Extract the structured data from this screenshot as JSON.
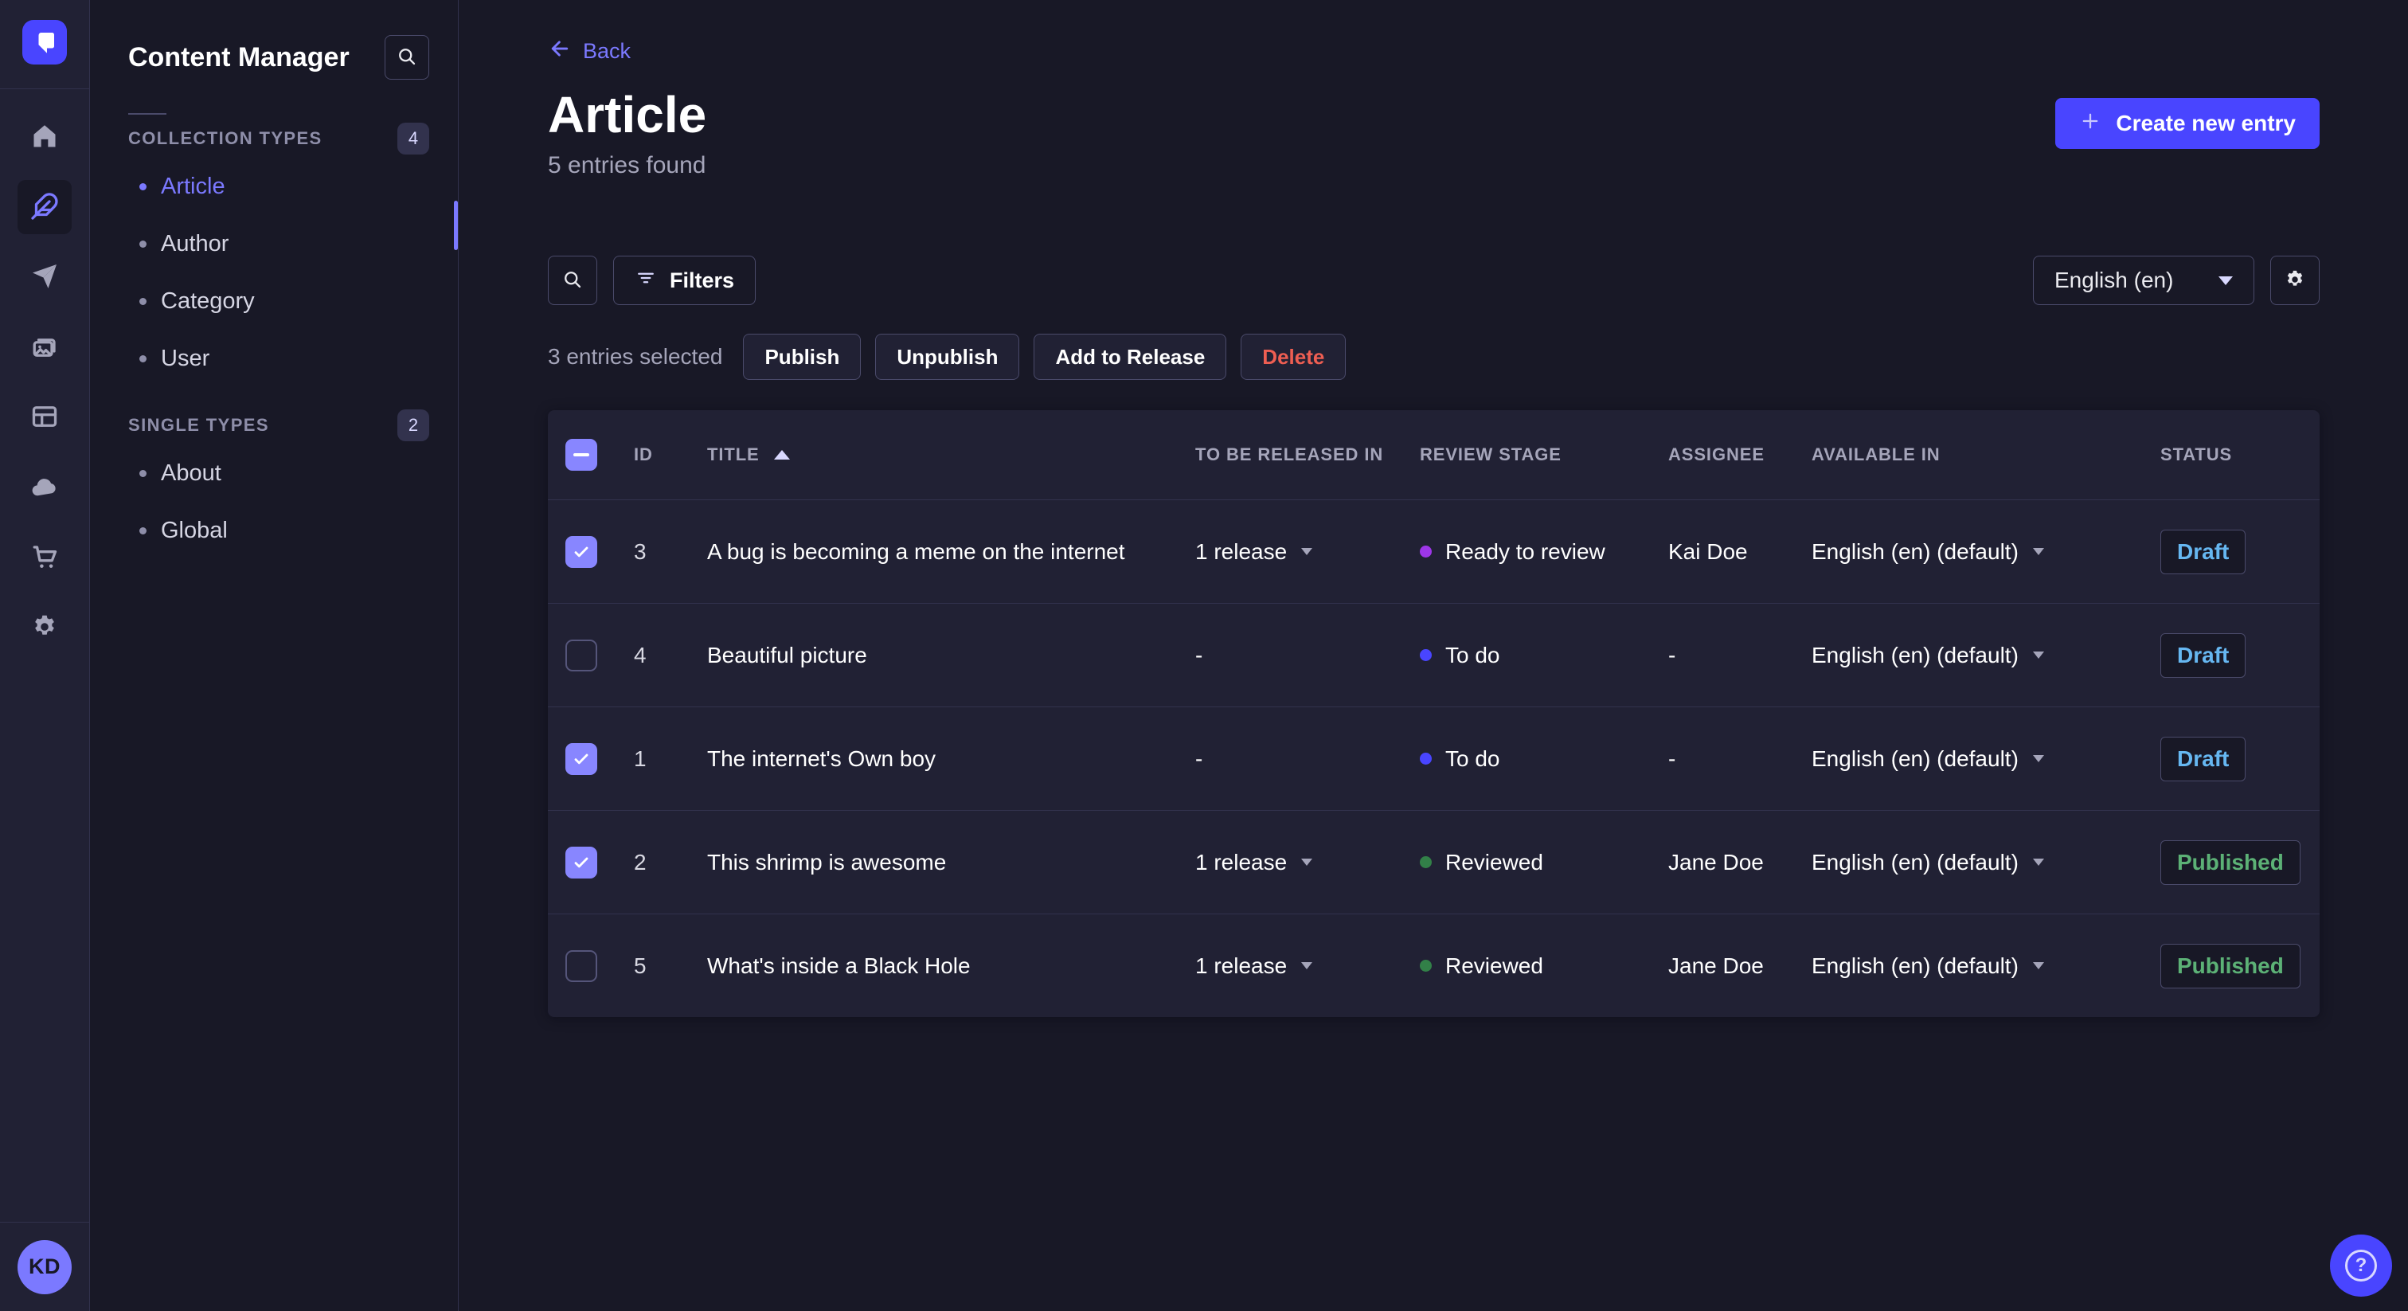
{
  "nav_rail": {
    "items": [
      {
        "icon": "home-icon",
        "active": false
      },
      {
        "icon": "feather-icon",
        "active": true
      },
      {
        "icon": "paper-plane-icon",
        "active": false
      },
      {
        "icon": "images-icon",
        "active": false
      },
      {
        "icon": "layout-icon",
        "active": false
      },
      {
        "icon": "cloud-icon",
        "active": false
      },
      {
        "icon": "cart-icon",
        "active": false
      },
      {
        "icon": "gear-icon",
        "active": false
      }
    ],
    "avatar_initials": "KD"
  },
  "sidebar": {
    "title": "Content Manager",
    "sections": [
      {
        "label": "COLLECTION TYPES",
        "count": "4",
        "items": [
          {
            "label": "Article",
            "active": true
          },
          {
            "label": "Author",
            "active": false
          },
          {
            "label": "Category",
            "active": false
          },
          {
            "label": "User",
            "active": false
          }
        ]
      },
      {
        "label": "SINGLE TYPES",
        "count": "2",
        "items": [
          {
            "label": "About",
            "active": false
          },
          {
            "label": "Global",
            "active": false
          }
        ]
      }
    ]
  },
  "header": {
    "back_label": "Back",
    "title": "Article",
    "subtitle": "5 entries found",
    "create_button_label": "Create new entry"
  },
  "toolbar": {
    "filters_label": "Filters",
    "locale_selected": "English (en)"
  },
  "selection": {
    "label": "3 entries selected",
    "publish_label": "Publish",
    "unpublish_label": "Unpublish",
    "add_to_release_label": "Add to Release",
    "delete_label": "Delete"
  },
  "table": {
    "header_checkbox_state": "indeterminate",
    "columns": [
      "ID",
      "TITLE",
      "TO BE RELEASED IN",
      "REVIEW STAGE",
      "ASSIGNEE",
      "AVAILABLE IN",
      "STATUS"
    ],
    "sort": {
      "column": "TITLE",
      "direction": "asc"
    },
    "rows": [
      {
        "checked": true,
        "id": "3",
        "title": "A bug is becoming a meme on the internet",
        "released": "1 release",
        "released_dropdown": true,
        "stage": {
          "label": "Ready to review",
          "color": "purple"
        },
        "assignee": "Kai Doe",
        "available": "English (en) (default)",
        "status": {
          "label": "Draft",
          "kind": "draft"
        }
      },
      {
        "checked": false,
        "id": "4",
        "title": "Beautiful picture",
        "released": "-",
        "released_dropdown": false,
        "stage": {
          "label": "To do",
          "color": "blue"
        },
        "assignee": "-",
        "available": "English (en) (default)",
        "status": {
          "label": "Draft",
          "kind": "draft"
        }
      },
      {
        "checked": true,
        "id": "1",
        "title": "The internet's Own boy",
        "released": "-",
        "released_dropdown": false,
        "stage": {
          "label": "To do",
          "color": "blue"
        },
        "assignee": "-",
        "available": "English (en) (default)",
        "status": {
          "label": "Draft",
          "kind": "draft"
        }
      },
      {
        "checked": true,
        "id": "2",
        "title": "This shrimp is awesome",
        "released": "1 release",
        "released_dropdown": true,
        "stage": {
          "label": "Reviewed",
          "color": "green"
        },
        "assignee": "Jane Doe",
        "available": "English (en) (default)",
        "status": {
          "label": "Published",
          "kind": "published"
        }
      },
      {
        "checked": false,
        "id": "5",
        "title": "What's inside a Black Hole",
        "released": "1 release",
        "released_dropdown": true,
        "stage": {
          "label": "Reviewed",
          "color": "green"
        },
        "assignee": "Jane Doe",
        "available": "English (en) (default)",
        "status": {
          "label": "Published",
          "kind": "published"
        }
      }
    ]
  },
  "help": {
    "icon_label": "?"
  },
  "colors": {
    "page_bg": "#181826",
    "panel_bg": "#212134",
    "border": "#32324d",
    "border_light": "#4a4a6a",
    "primary": "#4945ff",
    "primary_light": "#7b79ff",
    "text_dim": "#a5a5ba",
    "draft_text": "#66b7f1",
    "published_text": "#5cb176",
    "danger_text": "#ee5e52",
    "stage_purple": "#9d36e8",
    "stage_blue": "#4945ff",
    "stage_green": "#328048"
  }
}
